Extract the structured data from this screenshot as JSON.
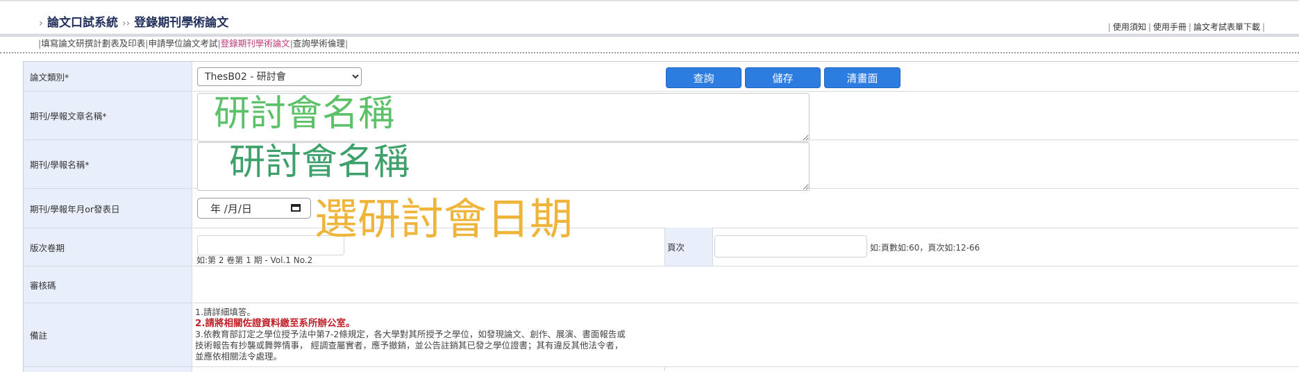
{
  "header": {
    "breadcrumb": [
      "論文口試系統",
      "登錄期刊學術論文"
    ],
    "links": [
      "使用須知",
      "使用手冊",
      "論文考試表單下載"
    ]
  },
  "subnav": {
    "items": [
      "填寫論文研撰計劃表及印表",
      "申請學位論文考試",
      "登錄期刊學術論文",
      "查詢學術倫理"
    ],
    "active_index": 2
  },
  "form": {
    "type_label": "論文類別*",
    "type_value": "ThesB02 - 研討會",
    "buttons": {
      "query": "查詢",
      "save": "儲存",
      "clear": "清畫面"
    },
    "article_label": "期刊/學報文章名稱*",
    "journal_label": "期刊/學報名稱*",
    "date_label": "期刊/學報年月or發表日",
    "date_placeholder": "年 /月/日",
    "volume_label": "版次卷期",
    "volume_hint": "如:第 2 卷第 1 期 - Vol.1 No.2",
    "page_label": "頁次",
    "page_hint": "如:頁數如:60，頁次如:12-66",
    "review_label": "審核碼",
    "remark_label": "備註",
    "notes": {
      "line1": "1.請詳細填答。",
      "line2": "2.請將相關佐證資料繳至系所辦公室。",
      "line3": "3.依教育部訂定之學位授予法中第7-2條規定，各大學對其所授予之學位，如發現論文、創作、展演、書面報告或",
      "line4": "技術報告有抄襲或舞弊情事， 經調查屬實者，應予撤銷，並公告註銷其已發之學位證書；其有違反其他法令者，",
      "line5": "並應依相關法令處理。"
    }
  },
  "annotations": {
    "article": "研討會名稱",
    "journal": "研討會名稱",
    "date": "選研討會日期"
  },
  "colors": {
    "label_bg": "#e9eefb",
    "button_bg": "#2d7de0",
    "active_link": "#c0397a",
    "note_red": "#c0202a",
    "annotation_green": "#5cc169",
    "annotation_dark_green": "#3ea16b",
    "annotation_yellow": "#efb53a"
  }
}
